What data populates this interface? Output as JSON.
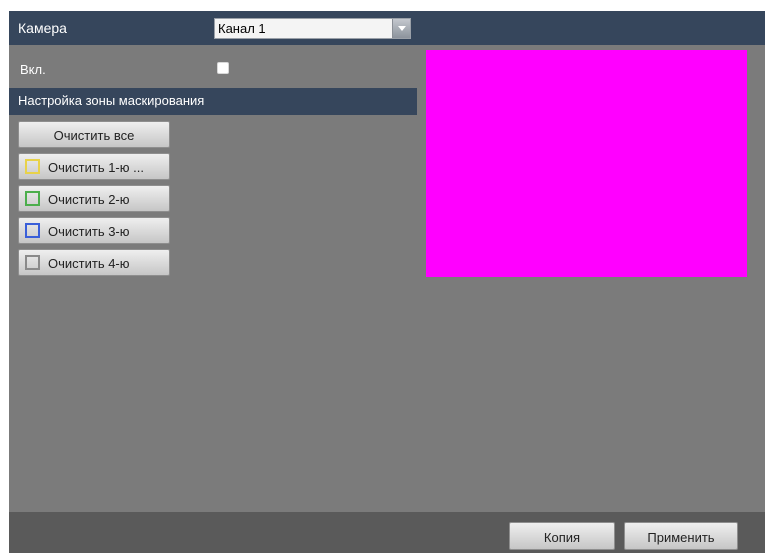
{
  "header": {
    "camera_label": "Камера",
    "channel_select": {
      "value": "Канал 1"
    }
  },
  "enable": {
    "label": "Вкл.",
    "checked": false
  },
  "section": {
    "title": "Настройка зоны маскирования"
  },
  "buttons": {
    "clear_all": "Очистить все",
    "areas": [
      {
        "label": "Очистить 1-ю ...",
        "color": "#e8d24a"
      },
      {
        "label": "Очистить 2-ю",
        "color": "#4cae4c"
      },
      {
        "label": "Очистить 3-ю",
        "color": "#3a5fd9"
      },
      {
        "label": "Очистить 4-ю",
        "color": "#8a8a8a"
      }
    ]
  },
  "preview": {
    "color": "#ff00ff"
  },
  "footer": {
    "copy_label": "Копия",
    "apply_label": "Применить"
  }
}
